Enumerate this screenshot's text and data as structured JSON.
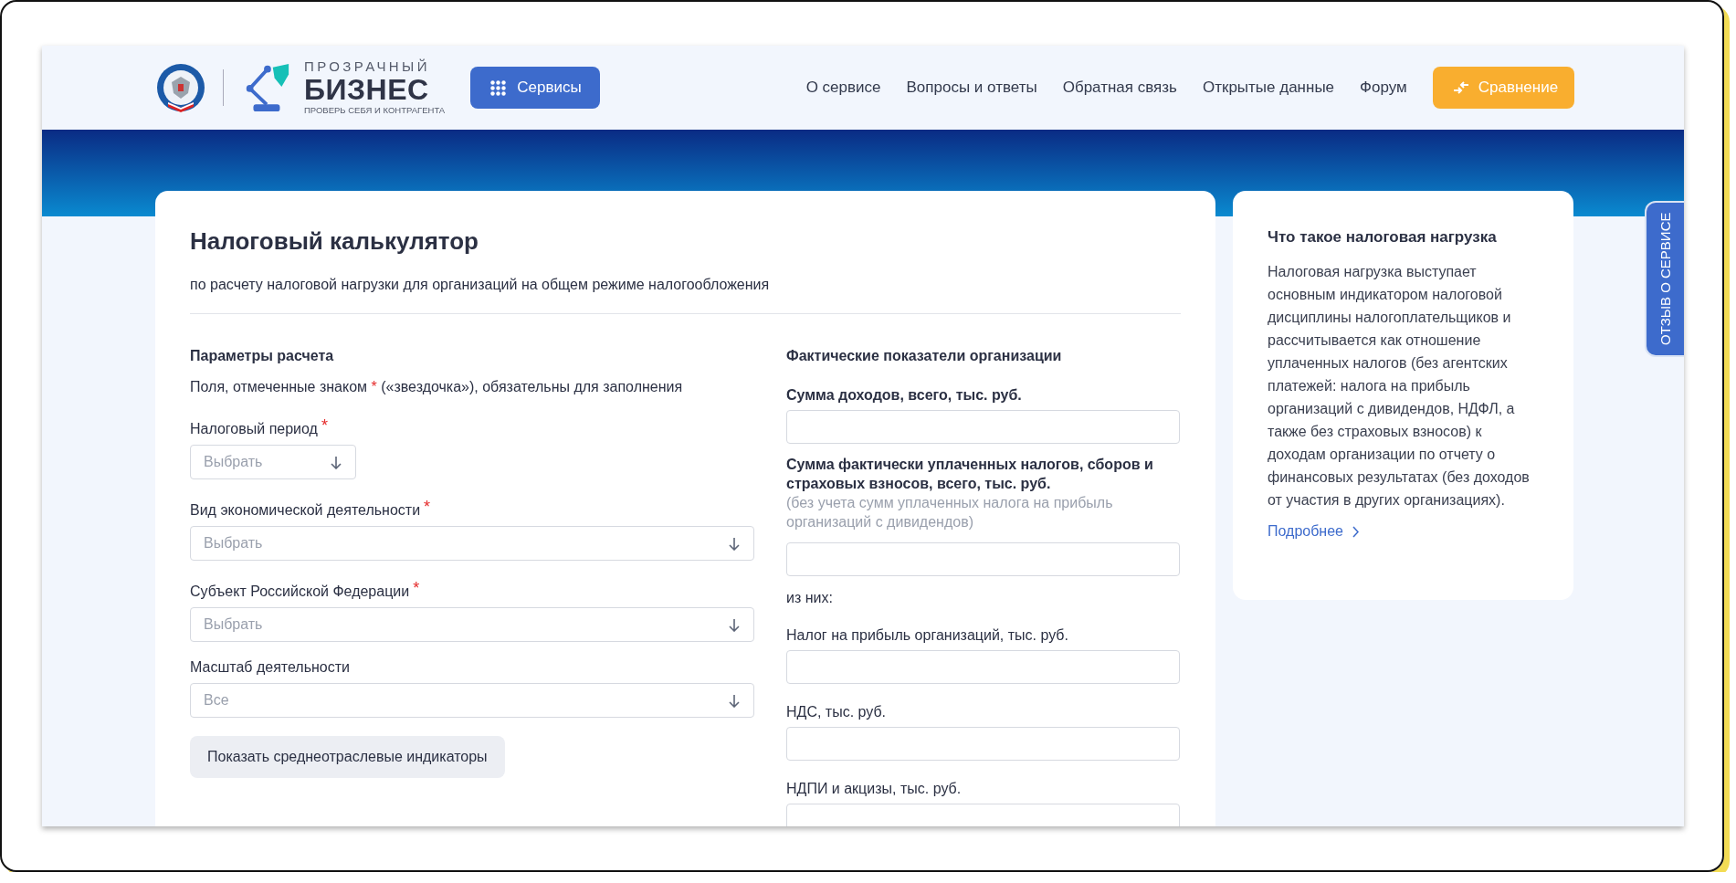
{
  "header": {
    "logo": {
      "top_line": "ПРОЗРАЧНЫЙ",
      "main_line": "БИЗНЕС",
      "tagline": "ПРОВЕРЬ СЕБЯ И КОНТРАГЕНТА"
    },
    "services_button": "Сервисы",
    "nav": [
      "О сервисе",
      "Вопросы и ответы",
      "Обратная связь",
      "Открытые данные",
      "Форум"
    ],
    "compare_button": "Сравнение"
  },
  "calculator": {
    "title": "Налоговый калькулятор",
    "subtitle": "по расчету налоговой нагрузки для организаций на общем режиме налогообложения",
    "parameters": {
      "heading": "Параметры расчета",
      "note": {
        "before": "Поля, отмеченные знаком ",
        "mark": "*",
        "after": " («звездочка»), обязательны для заполнения"
      },
      "fields": [
        {
          "label": "Налоговый период",
          "required_mark": "*",
          "placeholder": "Выбрать",
          "kind": "short"
        },
        {
          "label": "Вид экономической деятельности",
          "required_mark": "*",
          "placeholder": "Выбрать",
          "kind": "full"
        },
        {
          "label": "Субъект Российской Федерации",
          "required_mark": "*",
          "placeholder": "Выбрать",
          "kind": "full"
        },
        {
          "label": "Масштаб деятельности",
          "placeholder": "Все",
          "kind": "full"
        }
      ],
      "button": "Показать среднеотраслевые индикаторы"
    },
    "indicators": {
      "heading": "Фактические показатели организации",
      "items": [
        {
          "kind": "input",
          "label": "Сумма доходов, всего, тыс. руб.",
          "bold": true
        },
        {
          "kind": "input",
          "label": "Сумма фактически уплаченных налогов, сборов и страховых взносов, всего, тыс. руб.",
          "hint": "(без учета сумм уплаченных налога на прибыль организаций с дивидендов)",
          "bold": true
        },
        {
          "kind": "note",
          "text": "из них:"
        },
        {
          "kind": "input",
          "label": "Налог на прибыль организаций, тыс. руб.",
          "bold": false
        },
        {
          "kind": "input",
          "label": "НДС, тыс. руб.",
          "bold": false
        },
        {
          "kind": "input",
          "label": "НДПИ и акцизы, тыс. руб.",
          "bold": false
        }
      ]
    }
  },
  "info": {
    "title": "Что такое налоговая нагрузка",
    "text": "Налоговая нагрузка выступает основным индикатором налоговой дисциплины налогоплательщиков и рассчитывается как отношение уплаченных налогов (без агентских платежей: налога на прибыль организаций с дивидендов, НДФЛ, а также без страховых взносов) к доходам организации по отчету о финансовых результатах (без доходов от участия в других организациях).",
    "link": "Подробнее"
  },
  "feedback_tab": "ОТЗЫВ О СЕРВИСЕ"
}
